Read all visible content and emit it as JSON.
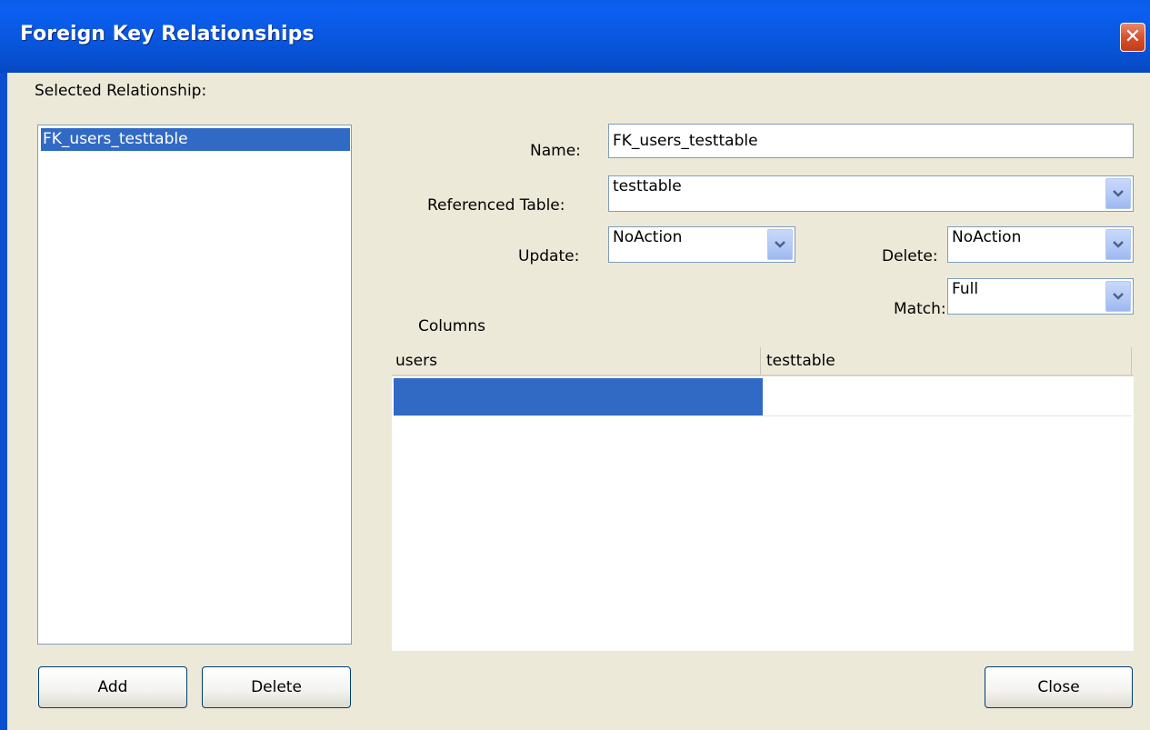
{
  "window": {
    "title": "Foreign Key Relationships",
    "close_glyph": "✕"
  },
  "left": {
    "label": "Selected Relationship:",
    "items": [
      "FK_users_testtable"
    ],
    "add_label": "Add",
    "delete_label": "Delete"
  },
  "form": {
    "name_label": "Name:",
    "name_value": "FK_users_testtable",
    "ref_table_label": "Referenced Table:",
    "ref_table_value": "testtable",
    "update_label": "Update:",
    "update_value": "NoAction",
    "delete_label": "Delete:",
    "delete_value": "NoAction",
    "match_label": "Match:",
    "match_value": "Full"
  },
  "columns": {
    "label": "Columns",
    "headers": [
      "users",
      "testtable"
    ],
    "rows": [
      [
        "",
        ""
      ]
    ]
  },
  "footer": {
    "close_label": "Close"
  },
  "colors": {
    "selection": "#316ac5",
    "titlebar": "#0a58e3",
    "window_bg": "#ece9d8"
  }
}
